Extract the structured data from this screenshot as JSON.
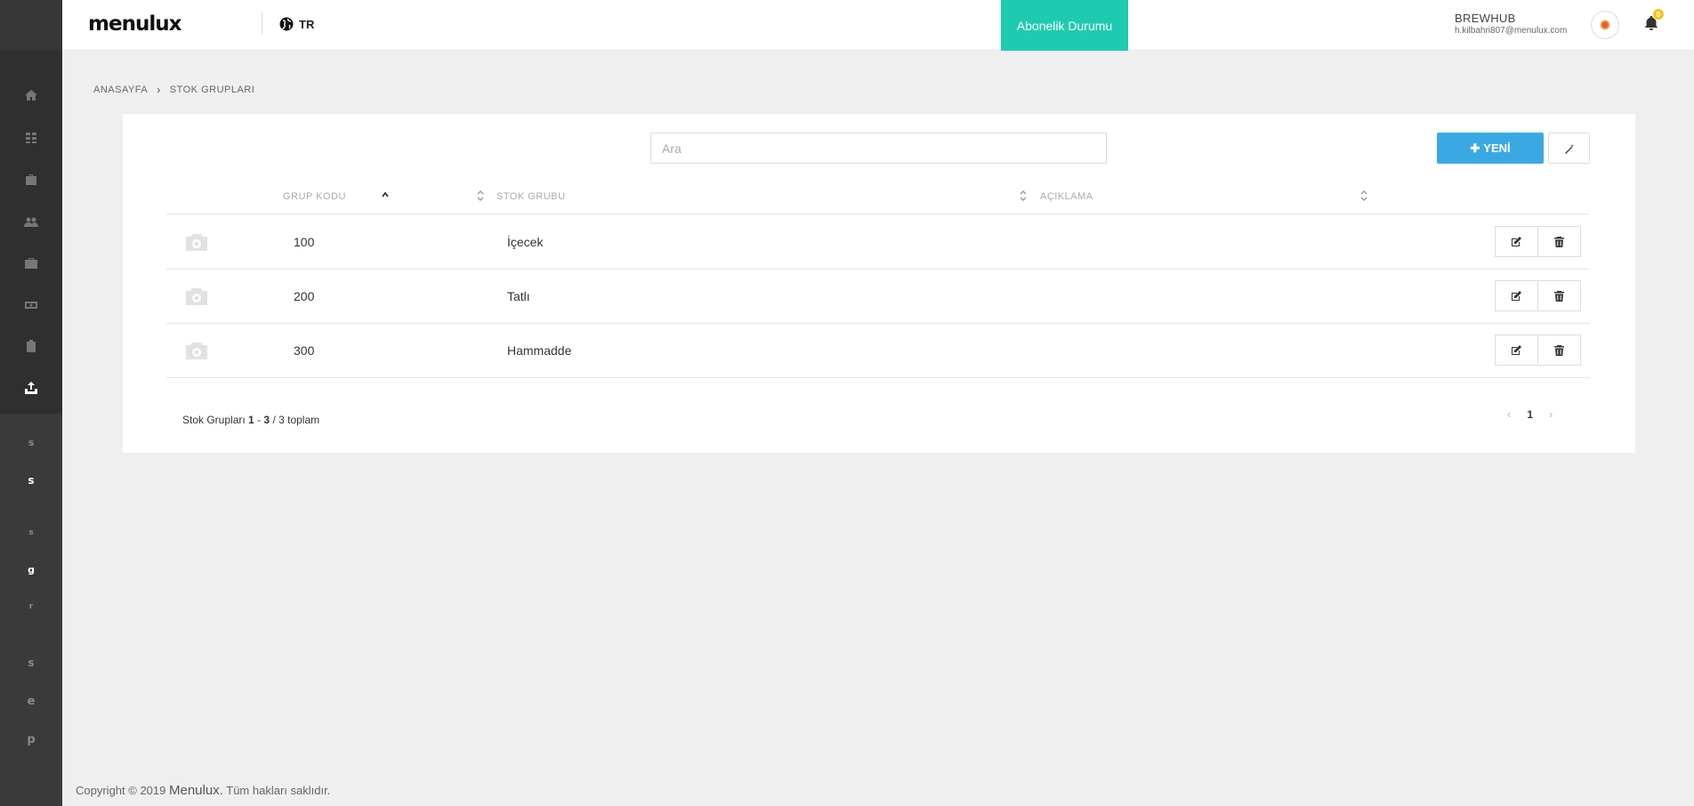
{
  "header": {
    "logo": "menulux",
    "lang": "TR",
    "subscription_label": "Abonelik Durumu",
    "user_name": "BREWHUB",
    "user_email": "h.kilbahri807@menulux.com",
    "notification_count": "0"
  },
  "sidebar": {
    "icons": [
      "home-icon",
      "grid-icon",
      "briefcase-icon",
      "users-icon",
      "suitcase-icon",
      "money-icon",
      "clipboard-icon",
      "upload-icon"
    ],
    "letters": [
      "s",
      "s",
      "s",
      "g",
      "r",
      "s",
      "e",
      "p"
    ]
  },
  "breadcrumb": {
    "home": "ANASAYFA",
    "current": "STOK GRUPLARI"
  },
  "toolbar": {
    "search_placeholder": "Ara",
    "new_label": "YENİ"
  },
  "table": {
    "headers": [
      "GRUP KODU",
      "STOK GRUBU",
      "AÇIKLAMA"
    ],
    "rows": [
      {
        "code": "100",
        "name": "İçecek",
        "description": ""
      },
      {
        "code": "200",
        "name": "Tatlı",
        "description": ""
      },
      {
        "code": "300",
        "name": "Hammadde",
        "description": ""
      }
    ]
  },
  "summary": {
    "label": "Stok Grupları",
    "from": "1",
    "to": "3",
    "total_text": "/ 3 toplam"
  },
  "pagination": {
    "current": "1"
  },
  "footer": {
    "prefix": "Copyright © 2019",
    "brand": "Menulux.",
    "suffix": "Tüm hakları saklıdır."
  },
  "colors": {
    "accent": "#1ecbb0",
    "primary_button": "#3aa9e3",
    "sidebar": "#3a3a3a",
    "notification_badge": "#f5c518"
  }
}
